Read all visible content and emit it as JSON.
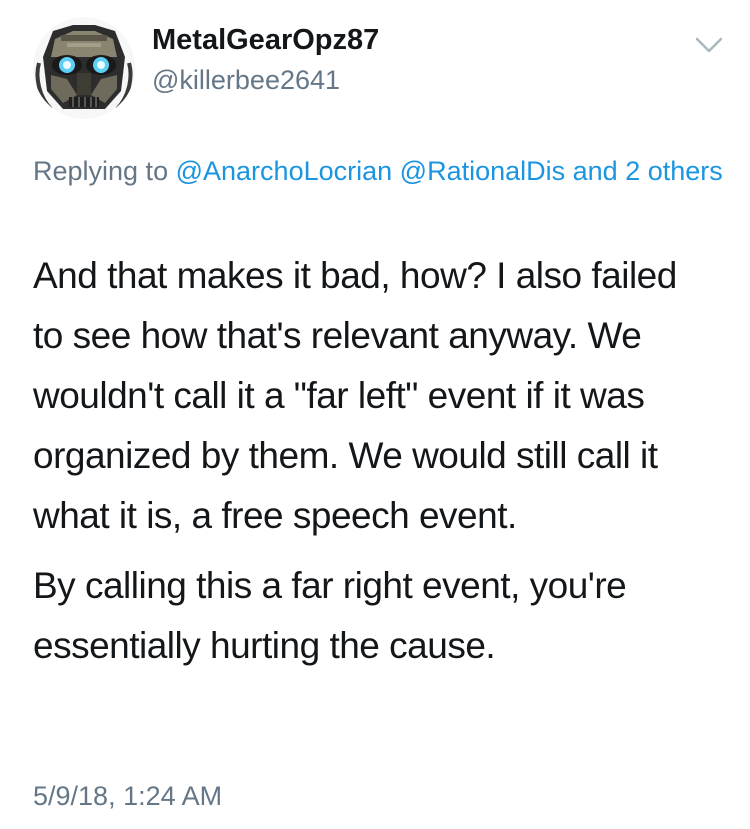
{
  "tweet": {
    "display_name": "MetalGearOpz87",
    "handle": "@killerbee2641",
    "replying_prefix": "Replying to",
    "reply_mentions": [
      "@AnarchoLocrian",
      "@RationalDis"
    ],
    "reply_connector": "and",
    "reply_others": "2 others",
    "paragraphs": [
      "And that makes it bad, how? I also failed to see how that's relevant anyway. We wouldn't call it a \"far left\" event if it was organized by them. We would still call it what it is, a free speech event.",
      "By calling this a far right event, you're essentially hurting the cause."
    ],
    "timestamp": "5/9/18, 1:24 AM"
  },
  "icons": {
    "avatar": "robot-mech-avatar",
    "menu": "chevron-down-icon"
  },
  "colors": {
    "text": "#14171a",
    "secondary": "#657786",
    "link": "#1b95e0",
    "avatar_eyes": "#5fd0f5"
  }
}
